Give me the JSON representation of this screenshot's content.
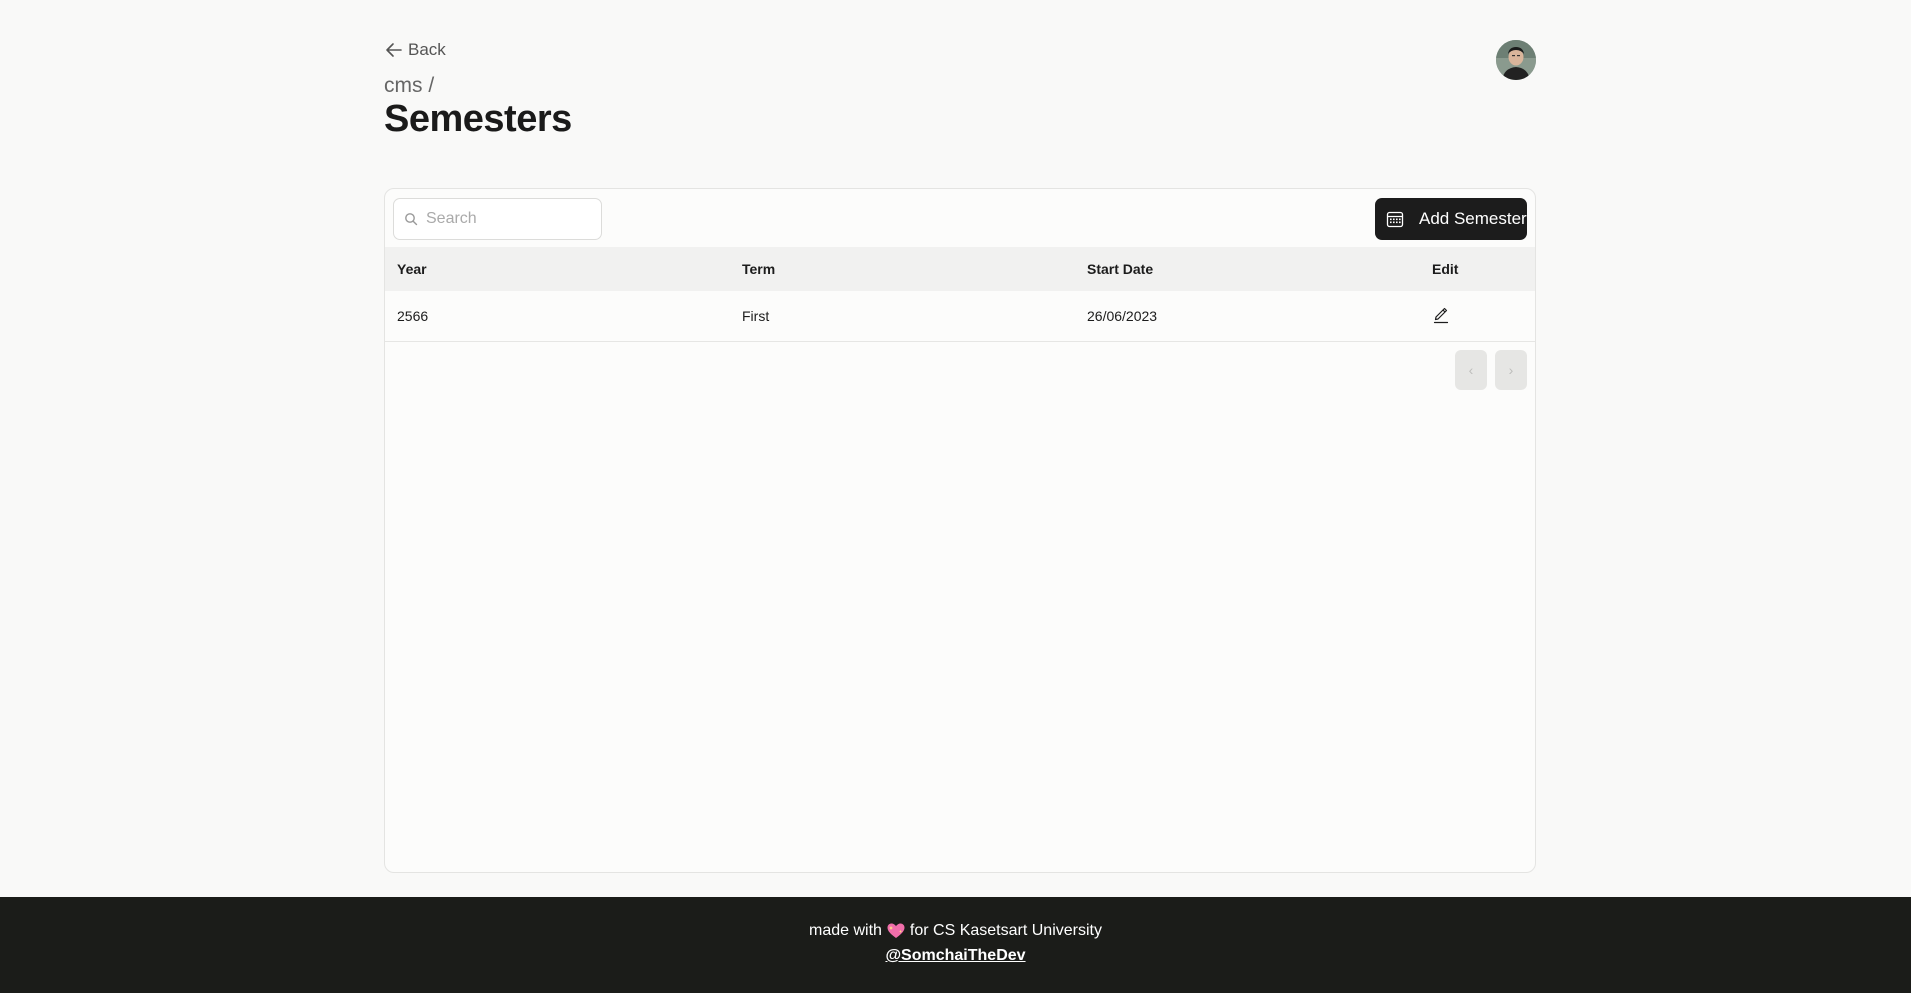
{
  "header": {
    "back_label": "Back",
    "breadcrumb": "cms /",
    "title": "Semesters",
    "avatar_icon": "user-avatar"
  },
  "toolbar": {
    "search_placeholder": "Search",
    "search_value": "",
    "search_icon": "search-icon",
    "add_button_label": "Add Semester",
    "add_button_icon": "calendar-icon"
  },
  "table": {
    "columns": [
      "Year",
      "Term",
      "Start Date",
      "Edit"
    ],
    "rows": [
      {
        "year": "2566",
        "term": "First",
        "start_date": "26/06/2023",
        "edit_icon": "pencil-icon"
      }
    ]
  },
  "pager": {
    "prev_icon": "chevron-left-icon",
    "next_icon": "chevron-right-icon",
    "prev_label": "‹",
    "next_label": "›"
  },
  "footer": {
    "made_with": "made with",
    "heart_icon": "sparkling-heart-icon",
    "for_text": "for CS Kasetsart University",
    "author_link": "@SomchaiTheDev"
  },
  "colors": {
    "background": "#f9f9f8",
    "primary_button": "#1c1c1c",
    "footer": "#1b1c19",
    "table_header": "#f1f1f0"
  }
}
